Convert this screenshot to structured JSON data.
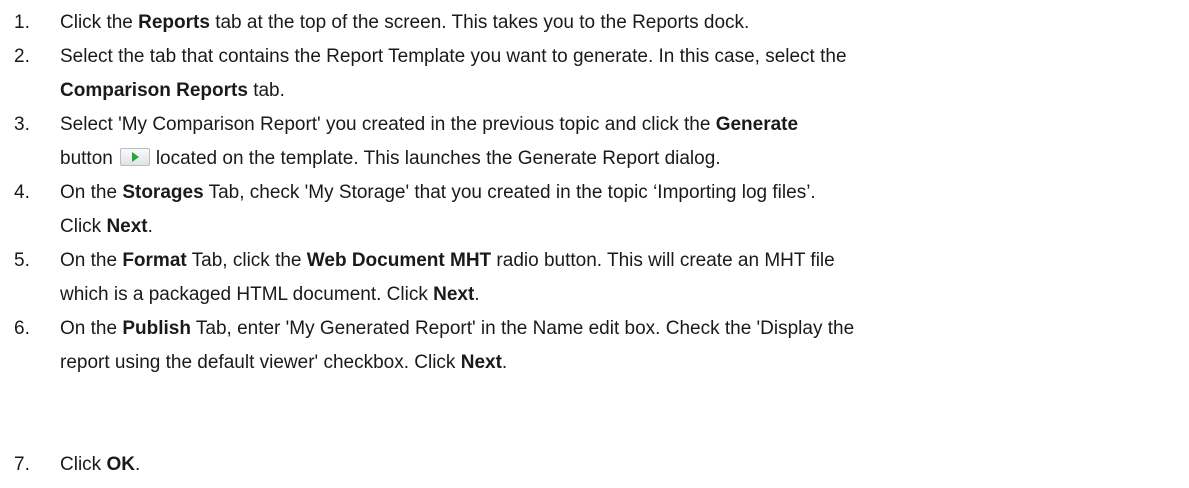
{
  "steps": [
    {
      "number": "1.",
      "line1": [
        {
          "t": "Click the "
        },
        {
          "t": "Reports",
          "b": true
        },
        {
          "t": " tab at the top of the screen. This takes you to the Reports dock."
        }
      ]
    },
    {
      "number": "2.",
      "line1": [
        {
          "t": "Select the tab that contains the Report Template you want to generate.  In this case, select the"
        }
      ],
      "line2": [
        {
          "t": "Comparison Reports",
          "b": true
        },
        {
          "t": " tab."
        }
      ]
    },
    {
      "number": "3.",
      "line1": [
        {
          "t": "Select 'My Comparison Report' you created in the previous topic and click the "
        },
        {
          "t": "Generate",
          "b": true
        }
      ],
      "line2_before": "button",
      "generate_icon": "play-icon",
      "line2_after": "located on the template. This launches the Generate Report dialog."
    },
    {
      "number": "4.",
      "line1": [
        {
          "t": "On the "
        },
        {
          "t": "Storages",
          "b": true
        },
        {
          "t": " Tab, check 'My Storage' that you created in the topic ‘Importing log files’."
        }
      ],
      "line2": [
        {
          "t": "Click "
        },
        {
          "t": "Next",
          "b": true
        },
        {
          "t": "."
        }
      ]
    },
    {
      "number": "5.",
      "line1": [
        {
          "t": "On the "
        },
        {
          "t": "Format",
          "b": true
        },
        {
          "t": " Tab, click the "
        },
        {
          "t": "Web Document MHT",
          "b": true
        },
        {
          "t": " radio button. This will create an MHT file"
        }
      ],
      "line2": [
        {
          "t": "which is a packaged HTML document. Click "
        },
        {
          "t": "Next",
          "b": true
        },
        {
          "t": "."
        }
      ]
    },
    {
      "number": "6.",
      "line1": [
        {
          "t": "On the "
        },
        {
          "t": "Publish",
          "b": true
        },
        {
          "t": " Tab, enter 'My Generated Report' in the Name edit box. Check the 'Display the"
        }
      ],
      "line2": [
        {
          "t": "report using the default viewer' checkbox. Click "
        },
        {
          "t": "Next",
          "b": true
        },
        {
          "t": "."
        }
      ]
    },
    {
      "number": "7.",
      "line1": [
        {
          "t": "Click "
        },
        {
          "t": "OK",
          "b": true
        },
        {
          "t": "."
        }
      ]
    }
  ]
}
